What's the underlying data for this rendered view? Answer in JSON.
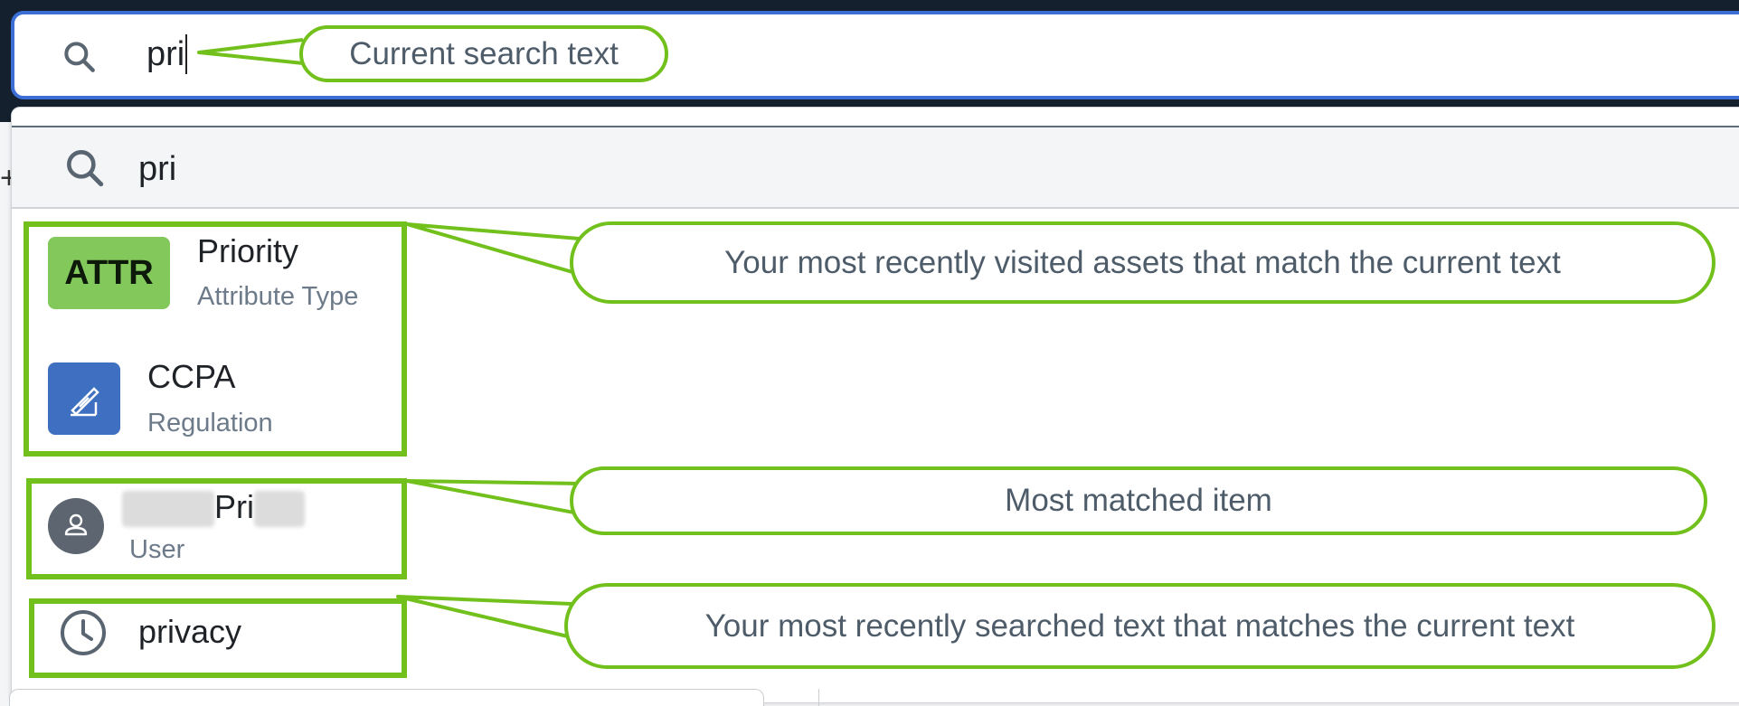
{
  "search": {
    "query": "pri"
  },
  "dropdown": {
    "query": "pri",
    "recent_assets": [
      {
        "badge": "ATTR",
        "badge_color": "#83c85a",
        "title": "Priority",
        "subtitle": "Attribute Type"
      },
      {
        "badge_icon": "regulation-icon",
        "badge_color": "#3f6fc0",
        "title": "CCPA",
        "subtitle": "Regulation"
      }
    ],
    "matched_item": {
      "icon": "user-avatar-icon",
      "title_visible": "Pri",
      "subtitle": "User"
    },
    "recent_search": {
      "icon": "clock-icon",
      "text": "privacy"
    }
  },
  "annotations": {
    "current_search": "Current search text",
    "recent_assets": "Your most recently visited assets that match the current text",
    "most_matched": "Most matched item",
    "recent_searches": "Your most recently searched text that matches the current text",
    "highlight_color": "#72c01c"
  }
}
